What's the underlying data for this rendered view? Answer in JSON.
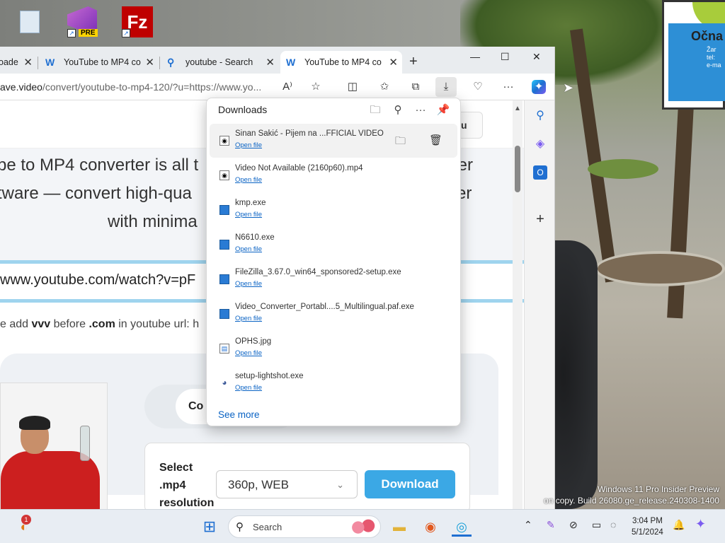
{
  "browser": {
    "tabs": [
      {
        "label": "oade",
        "favicon": "w-icon"
      },
      {
        "label": "YouTube to MP4 co",
        "favicon": "w-icon"
      },
      {
        "label": "youtube - Search",
        "favicon": "search-icon"
      },
      {
        "label": "YouTube to MP4 co",
        "favicon": "w-icon",
        "active": true
      }
    ],
    "new_tab": "+",
    "url_host": "ave.video",
    "url_path": "/convert/youtube-to-mp4-120/?u=https://www.yo...",
    "read_aloud": "A⁾"
  },
  "page": {
    "top_button": "u",
    "hero_lines": [
      "be to MP4 converter is all t",
      "ter",
      "tware — convert high-qua",
      "er",
      "with minima"
    ],
    "input_value": "www.youtube.com/watch?v=pF",
    "hint_prefix": "e add ",
    "hint_vvv": "vvv",
    "hint_mid": " before ",
    "hint_com": ".com",
    "hint_suffix": " in youtube url: h",
    "tab_pill": "Co",
    "select_label": "Select .mp4 resolution",
    "resolution": "360p, WEB",
    "download_button": "Download"
  },
  "downloads": {
    "title": "Downloads",
    "open_file": "Open file",
    "items": [
      {
        "name": "Sinan Sakić - Pijem na ...FFICIAL VIDEO",
        "type": "video"
      },
      {
        "name": "Video Not Available (2160p60).mp4",
        "type": "video"
      },
      {
        "name": "kmp.exe",
        "type": "exe"
      },
      {
        "name": "N6610.exe",
        "type": "exe"
      },
      {
        "name": "FileZilla_3.67.0_win64_sponsored2-setup.exe",
        "type": "exe"
      },
      {
        "name": "Video_Converter_Portabl....5_Multilingual.paf.exe",
        "type": "exe"
      },
      {
        "name": "OPHS.jpg",
        "type": "image"
      },
      {
        "name": "setup-lightshot.exe",
        "type": "exe"
      }
    ],
    "see_more": "See more"
  },
  "desktop": {
    "pre_badge": "PRE",
    "filezilla_letter": "Fz",
    "billboard_text": "Očna",
    "billboard_sub": "Žar\ntel:\ne-ma"
  },
  "watermark": {
    "line1": "Windows 11 Pro Insider Preview",
    "line2": "on copy. Build 26080.ge_release.240308-1400"
  },
  "taskbar": {
    "search_label": "Search",
    "notification_count": "1",
    "time": "3:04 PM",
    "date": "5/1/2024"
  }
}
